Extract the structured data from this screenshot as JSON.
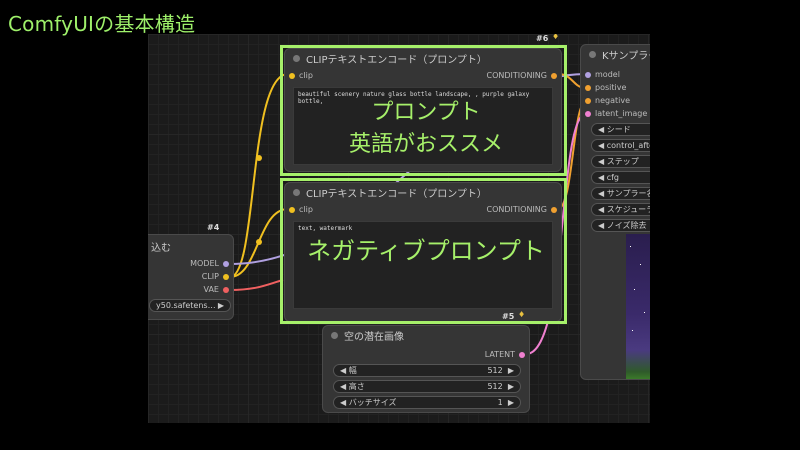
{
  "slide": {
    "title": "ComfyUIの基本構造"
  },
  "nodes": {
    "checkpoint": {
      "badge": "#4",
      "title_fragment": "込む",
      "outputs": [
        "MODEL",
        "CLIP",
        "VAE"
      ],
      "ckpt_value": "y50.safetens…"
    },
    "clip_positive": {
      "badge": "#6",
      "title": "CLIPテキストエンコード（プロンプト）",
      "input": "clip",
      "output": "CONDITIONING",
      "text": "beautiful scenery nature glass bottle landscape, , purple galaxy bottle,"
    },
    "clip_negative": {
      "badge": "#5",
      "title": "CLIPテキストエンコード（プロンプト）",
      "input": "clip",
      "output": "CONDITIONING",
      "text": "text, watermark"
    },
    "ksampler": {
      "title": "Kサンプラー",
      "inputs": [
        "model",
        "positive",
        "negative",
        "latent_image"
      ],
      "widgets": [
        "シード",
        "control_after_",
        "ステップ",
        "cfg",
        "サンプラー名",
        "スケジューラ",
        "ノイズ除去"
      ]
    },
    "latent": {
      "title": "空の潜在画像",
      "output": "LATENT",
      "widgets": [
        {
          "label": "幅",
          "value": "512"
        },
        {
          "label": "高さ",
          "value": "512"
        },
        {
          "label": "バッチサイズ",
          "value": "1"
        }
      ]
    }
  },
  "annotations": {
    "positive_line1": "プロンプト",
    "positive_line2": "英語がおススメ",
    "negative": "ネガティブプロンプト"
  },
  "colors": {
    "accent_green": "#a6f06a",
    "wire_clip": "#f0c020",
    "wire_model": "#b0a0e0",
    "wire_vae": "#f06060",
    "wire_conditioning": "#f0a030",
    "wire_latent": "#f080d0"
  }
}
